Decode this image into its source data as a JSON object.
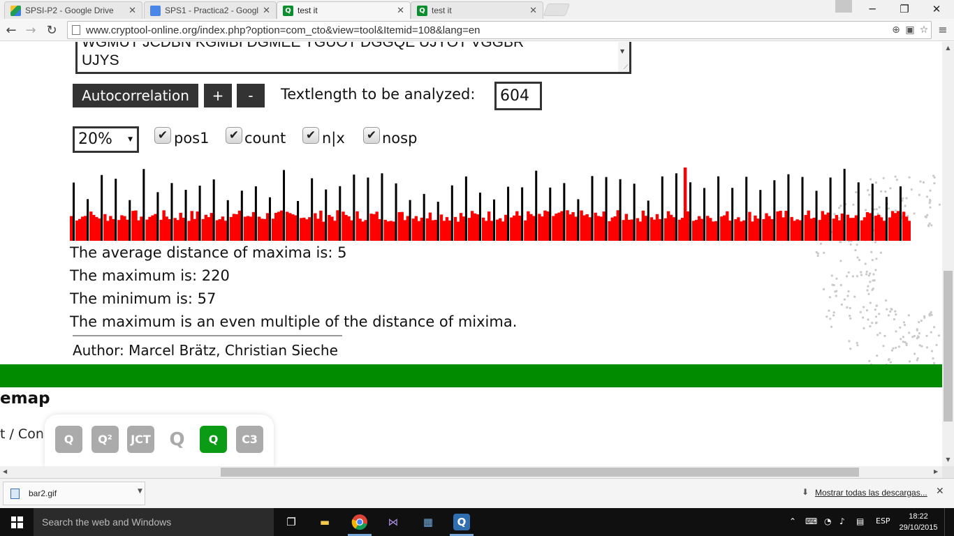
{
  "browser": {
    "tabs": [
      {
        "title": "SPSI-P2 - Google Drive",
        "favicon": "google-drive-icon"
      },
      {
        "title": "SPS1 - Practica2 - Google",
        "favicon": "google-docs-icon"
      },
      {
        "title": "test it",
        "favicon": "cryptool-icon",
        "active": true
      },
      {
        "title": "test it",
        "favicon": "cryptool-icon"
      }
    ],
    "url": "www.cryptool-online.org/index.php?option=com_cto&view=tool&Itemid=108&lang=en"
  },
  "page": {
    "ciphertext": "WGMUT JCDBN KGMBI DGMEE YGUOT DGGQE UJYOT VGGBR\nUJYS",
    "controls": {
      "autocorrelation_label": "Autocorrelation",
      "plus_label": "+",
      "minus_label": "-",
      "textlength_label": "Textlength to be analyzed:",
      "textlength_value": "604",
      "percent_value": "20%",
      "checkboxes": [
        {
          "label": "pos1",
          "checked": true
        },
        {
          "label": "count",
          "checked": true
        },
        {
          "label": "n|x",
          "checked": true
        },
        {
          "label": "nosp",
          "checked": true
        }
      ]
    },
    "results": {
      "avg_distance": "The average distance of maxima is: 5",
      "maximum": "The maximum is: 220",
      "minimum": "The minimum is: 57",
      "conclusion": "The maximum is an even multiple of the distance of mixima."
    },
    "author": "Author: Marcel Brätz, Christian Sieche",
    "footer": {
      "sitemap": "emap",
      "contact": "t / Con"
    },
    "logos": [
      "ct1-logo",
      "ct2-logo",
      "jct-logo",
      "cto-faded-logo",
      "cto-logo",
      "ct3-logo"
    ],
    "logo_text": {
      "jct": "JCT",
      "c3": "C3"
    }
  },
  "chart_data": {
    "type": "bar",
    "description_colors": {
      "normal": "#ff0000",
      "maxima": "#000000"
    },
    "ylim": [
      0,
      220
    ],
    "minimum": 57,
    "maximum": 220,
    "bar_count": 300,
    "maxima_every": 5
  },
  "downloads": {
    "file_name": "bar2.gif",
    "show_all": "Mostrar todas las descargas..."
  },
  "taskbar": {
    "search_placeholder": "Search the web and Windows",
    "language": "ESP",
    "time": "18:22",
    "date": "29/10/2015"
  },
  "colors": {
    "accent_green": "#008b00",
    "dark_button": "#333333",
    "bar_red": "#ff0000"
  }
}
